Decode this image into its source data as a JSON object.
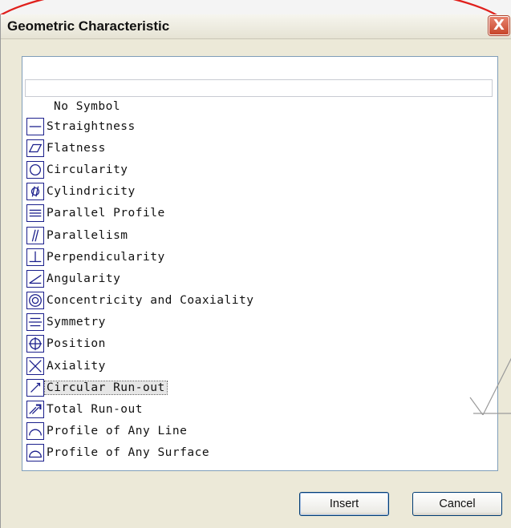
{
  "window": {
    "title": "Geometric Characteristic",
    "close_label": "X"
  },
  "filter": {
    "value": ""
  },
  "list": {
    "items": [
      {
        "label": "No Symbol",
        "icon": null
      },
      {
        "label": "Straightness",
        "icon": "straightness-icon"
      },
      {
        "label": "Flatness",
        "icon": "flatness-icon"
      },
      {
        "label": "Circularity",
        "icon": "circularity-icon"
      },
      {
        "label": "Cylindricity",
        "icon": "cylindricity-icon"
      },
      {
        "label": "Parallel Profile",
        "icon": "parallel-profile-icon"
      },
      {
        "label": "Parallelism",
        "icon": "parallelism-icon"
      },
      {
        "label": "Perpendicularity",
        "icon": "perpendicularity-icon"
      },
      {
        "label": "Angularity",
        "icon": "angularity-icon"
      },
      {
        "label": "Concentricity and Coaxiality",
        "icon": "concentricity-icon"
      },
      {
        "label": "Symmetry",
        "icon": "symmetry-icon"
      },
      {
        "label": "Position",
        "icon": "position-icon"
      },
      {
        "label": "Axiality",
        "icon": "axiality-icon"
      },
      {
        "label": "Circular Run-out",
        "icon": "circular-runout-icon",
        "selected": true
      },
      {
        "label": "Total Run-out",
        "icon": "total-runout-icon"
      },
      {
        "label": "Profile of Any Line",
        "icon": "profile-line-icon"
      },
      {
        "label": "Profile of Any Surface",
        "icon": "profile-surface-icon"
      }
    ]
  },
  "buttons": {
    "insert_label": "Insert",
    "cancel_label": "Cancel"
  },
  "colors": {
    "dialog_bg": "#ece9d8",
    "icon_stroke": "#1b1f8c",
    "close_button": "#c7462b",
    "highlight_circle": "#e0201c"
  }
}
